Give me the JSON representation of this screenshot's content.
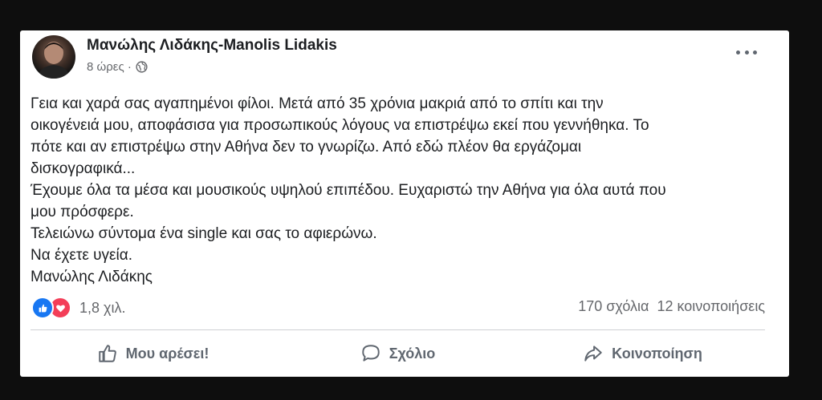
{
  "post": {
    "author": "Μανώλης Λιδάκης-Manolis Lidakis",
    "time": "8 ώρες ·",
    "privacy_icon": "globe-icon",
    "more_icon": "more-options-icon",
    "lines": [
      "Γεια και χαρά σας αγαπημένοι φίλοι. Μετά από 35 χρόνια μακριά από το σπίτι και την",
      "οικογένειά μου,  αποφάσισα για προσωπικούς λόγους να επιστρέψω εκεί που γεννήθηκα. Το",
      "πότε και αν επιστρέψω στην Αθήνα δεν το γνωρίζω. Από εδώ πλέον θα εργάζομαι",
      "δισκογραφικά...",
      "Έχουμε όλα τα μέσα και μουσικούς υψηλού επιπέδου. Ευχαριστώ την  Αθήνα για όλα αυτά που",
      "μου πρόσφερε.",
      "Τελειώνω σύντομα ένα single και σας το αφιερώνω.",
      "Να έχετε υγεία.",
      "Μανώλης Λιδάκης"
    ]
  },
  "reactions": {
    "icons": [
      "like-reaction-icon",
      "love-reaction-icon"
    ],
    "count": "1,8 χιλ."
  },
  "stats": {
    "comments": "170 σχόλια",
    "shares": "12 κοινοποιήσεις"
  },
  "actions": {
    "like": "Μου αρέσει!",
    "comment": "Σχόλιο",
    "share": "Κοινοποίηση"
  },
  "colors": {
    "like_blue": "#1877f2",
    "love_red": "#f33e58",
    "secondary_text": "#65676b"
  }
}
